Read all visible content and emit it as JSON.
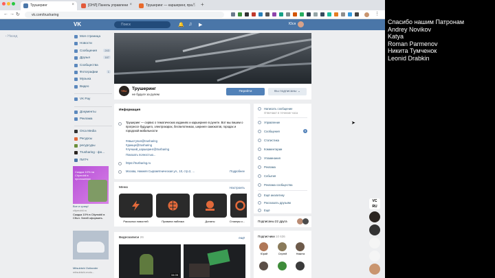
{
  "browser": {
    "tabs": [
      {
        "title": "Трушеринг",
        "active": true
      },
      {
        "title": "[ОНЛ] Панель управлени",
        "active": false
      },
      {
        "title": "Трушеринг — каршеринг, пра...",
        "active": false
      }
    ],
    "url": "vk.com/trusharing"
  },
  "vk": {
    "logo": "VK",
    "search_placeholder": "Поиск",
    "user_name": "Юся"
  },
  "left": {
    "back_label": "Назад",
    "menu": [
      {
        "label": "Моя страница",
        "count": ""
      },
      {
        "label": "Новости",
        "count": ""
      },
      {
        "label": "Сообщения",
        "count": "243"
      },
      {
        "label": "Друзья",
        "count": "187"
      },
      {
        "label": "Сообщества",
        "count": ""
      },
      {
        "label": "Фотографии",
        "count": "1"
      },
      {
        "label": "Музыка",
        "count": ""
      },
      {
        "label": "Видео",
        "count": ""
      }
    ],
    "menu2": [
      {
        "label": "VK Pay"
      }
    ],
    "menu3": [
      {
        "label": "Документы"
      },
      {
        "label": "Реклама"
      }
    ],
    "menu4": [
      {
        "label": "Orca Media"
      },
      {
        "label": "Ресурсы"
      },
      {
        "label": "ресурсуры"
      },
      {
        "label": "Trusharing - фо..."
      },
      {
        "label": "ПИТЧ"
      }
    ],
    "ad1": {
      "banner": "Скидка 10% на Citymobil в приложении",
      "title": "Все и сразу!",
      "domain": "citymobil.ru",
      "text": "Скидка 10% в Citymobil в Сбол. Успей оформить."
    },
    "ad2": {
      "title": "Mitsubishi Outlander",
      "domain": "mitsubishi-moto..."
    }
  },
  "group": {
    "name": "Трушеринг",
    "status": "не будьте за рулем",
    "avatar_text": "TRU",
    "join_label": "Перейти",
    "subscribed_label": "Вы подписаны"
  },
  "info": {
    "title": "Информация",
    "description": "Трушеринг — сервис о тематических изданиях и каршеринге в рунете. Вот мы пишем о прогрессе будущего, электрокарах, беспилотниках, шеринге самокатов, городах и городской мобильности",
    "hashtags": "#явыступил@trusharing\n#днище@trusharing\n#лучший_каршеринг@trusharing",
    "more": "Показать полностью...",
    "site": "https://trusharing.ru",
    "address": "Москва, Нижняя Сыромятническая ул., 10, стр.2, ...",
    "details_link": "Подробнее"
  },
  "apps": {
    "title": "Меню",
    "configure": "Настроить",
    "items": [
      {
        "label": "Рассылка новостей"
      },
      {
        "label": "Правила паблика"
      },
      {
        "label": "Донаты"
      },
      {
        "label": "Стикеры к..."
      }
    ]
  },
  "videos": {
    "title": "Видеозаписи",
    "count": "26",
    "all": "ещё",
    "durations": [
      "34:05",
      ""
    ]
  },
  "rightmenu": {
    "top": [
      {
        "label": "Написать сообщение"
      },
      {
        "label": "Отвечают в течение часа"
      }
    ],
    "items": [
      {
        "label": "Управление",
        "badge": ""
      },
      {
        "label": "Сообщения",
        "badge": "5"
      },
      {
        "label": "Статистика",
        "badge": ""
      },
      {
        "label": "Комментарии",
        "badge": ""
      },
      {
        "label": "Упоминания",
        "badge": ""
      },
      {
        "label": "Реклама",
        "badge": ""
      },
      {
        "label": "События",
        "badge": ""
      },
      {
        "label": "Реклама сообщества",
        "badge": ""
      }
    ],
    "bottom": [
      {
        "label": "Ещё аналитику"
      },
      {
        "label": "Рассказать друзьям"
      },
      {
        "label": "Ещё"
      }
    ]
  },
  "subscriptions": {
    "title": "Подписаны 22 друга"
  },
  "subscribers": {
    "title": "Подписчики",
    "count": "10 636",
    "people": [
      {
        "name": "Юрий"
      },
      {
        "name": "Сергей"
      },
      {
        "name": "Никита"
      },
      {
        "name": ""
      },
      {
        "name": ""
      },
      {
        "name": ""
      }
    ]
  },
  "patrons": {
    "title": "Спасибо нашим Патронам",
    "names": [
      "Andrey Novikov",
      "Katya",
      "Roman Parmenov",
      "Никита Тумченок",
      "Leonid Drabkin"
    ]
  },
  "colors": {
    "vk_blue": "#4a76a8",
    "button_blue": "#5181b8",
    "page_bg": "#edeef0",
    "link": "#285473"
  }
}
